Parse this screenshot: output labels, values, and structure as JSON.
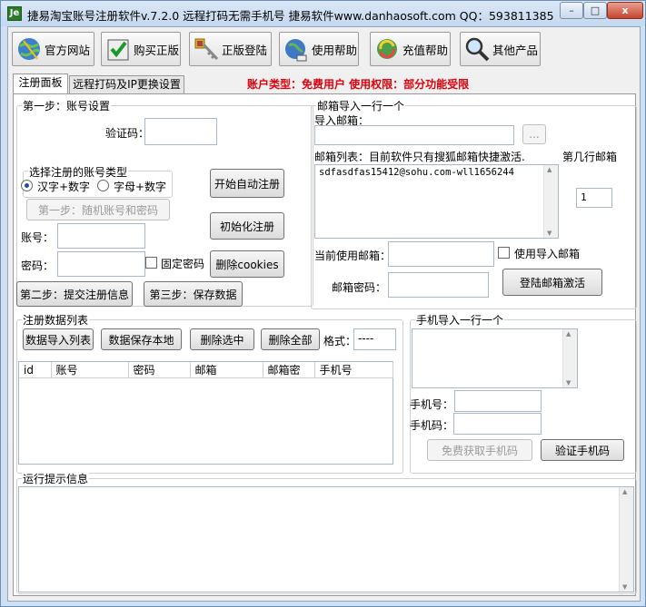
{
  "window": {
    "title": "捷易淘宝账号注册软件v.7.2.0    远程打码无需手机号  捷易软件www.danhaosoft.com  QQ：593811385",
    "controls": {
      "minimize": "–",
      "maximize": "□",
      "close": "x"
    }
  },
  "toolbar": {
    "items": [
      {
        "label": "官方网站",
        "icon": "globe-icon"
      },
      {
        "label": "购买正版",
        "icon": "checkmark-icon"
      },
      {
        "label": "正版登陆",
        "icon": "keys-icon"
      },
      {
        "label": "使用帮助",
        "icon": "help-globe-icon"
      },
      {
        "label": "充值帮助",
        "icon": "refresh-icon"
      },
      {
        "label": "其他产品",
        "icon": "magnifier-icon"
      }
    ]
  },
  "tabs": [
    {
      "label": "注册面板"
    },
    {
      "label": "远程打码及IP更换设置"
    }
  ],
  "account_status": "账户类型：免费用户    使用权限：部分功能受限",
  "step1": {
    "group_title": "第一步：账号设置",
    "captcha_label": "验证码：",
    "captcha_value": "",
    "account_type_group": "选择注册的账号类型",
    "radio_cn_digit": "汉字+数字",
    "radio_alpha_digit": "字母+数字",
    "random_button": "第一步：随机账号和密码",
    "start_button": "开始自动注册",
    "init_button": "初始化注册",
    "account_label": "账号：",
    "account_value": "",
    "password_label": "密码：",
    "password_value": "",
    "fixed_password_label": "固定密码",
    "delete_cookies_button": "删除cookies",
    "submit_button": "第二步：提交注册信息",
    "save_button": "第三步：保存数据"
  },
  "mail": {
    "group_title": "邮箱导入一行一个",
    "import_label": "导入邮箱：",
    "import_value": "",
    "browse_button": "...",
    "list_label": "邮箱列表：目前软件只有搜狐邮箱快捷激活.",
    "row_label": "第几行邮箱",
    "row_value": "1",
    "list_content": "sdfasdfas15412@sohu.com-wll1656244",
    "current_label": "当前使用邮箱：",
    "current_value": "",
    "use_import_label": "使用导入邮箱",
    "password_label": "邮箱密码：",
    "password_value": "",
    "login_button": "登陆邮箱激活"
  },
  "data_list": {
    "group_title": "注册数据列表",
    "import_button": "数据导入列表",
    "save_local_button": "数据保存本地",
    "delete_selected_button": "删除选中",
    "delete_all_button": "删除全部",
    "format_label": "格式：",
    "format_value": "----",
    "columns": [
      "id",
      "账号",
      "密码",
      "邮箱",
      "邮箱密",
      "手机号"
    ]
  },
  "phone": {
    "group_title": "手机导入一行一个",
    "phone_label": "手机号：",
    "phone_value": "",
    "code_label": "手机码：",
    "code_value": "",
    "free_button": "免费获取手机码",
    "verify_button": "验证手机码"
  },
  "log": {
    "group_title": "运行提示信息"
  }
}
